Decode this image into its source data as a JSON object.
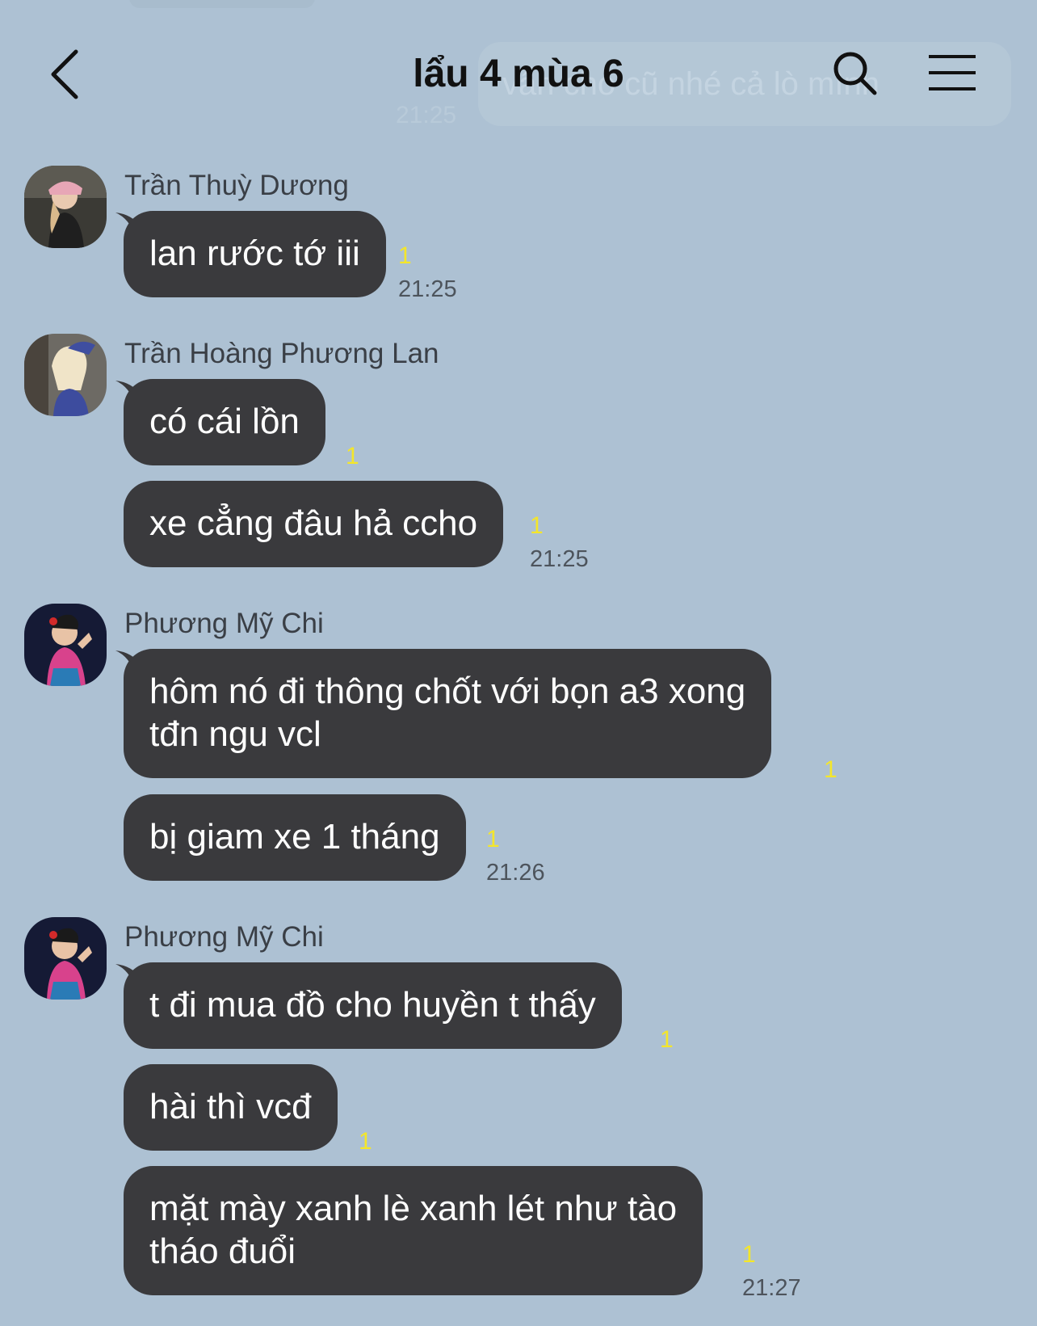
{
  "header": {
    "title": "lẩu 4 mùa 6"
  },
  "background": {
    "ghost_message": "vẫn cho cũ nhé cả lò mình",
    "ghost_time": "21:25"
  },
  "messages": [
    {
      "sender": "Trần Thuỳ Dương",
      "text": "lan rước tớ iii",
      "unread": "1",
      "time": "21:25"
    },
    {
      "sender": "Trần Hoàng Phương Lan",
      "text": "có cái lồn",
      "unread": "1"
    },
    {
      "text": "xe cẳng đâu hả ccho",
      "unread": "1",
      "time": "21:25"
    },
    {
      "sender": "Phương Mỹ Chi",
      "text_lines": [
        "hôm nó đi thông chốt với bọn a3 xong",
        "tđn ngu vcl"
      ],
      "unread": "1"
    },
    {
      "text": "bị giam xe 1 tháng",
      "unread": "1",
      "time": "21:26"
    },
    {
      "sender": "Phương Mỹ Chi",
      "text": "t đi mua đồ cho huyền t thấy",
      "unread": "1"
    },
    {
      "text": "hài thì vcđ",
      "unread": "1"
    },
    {
      "text_lines": [
        "mặt mày xanh lè xanh lét như tào",
        "tháo đuổi"
      ],
      "unread": "1",
      "time": "21:27"
    }
  ],
  "colors": {
    "background": "#adc1d3",
    "bubble": "#3a3a3d",
    "bubble_text": "#ffffff",
    "unread": "#f4e62a",
    "title": "#111111"
  },
  "icons": [
    "back-chevron-icon",
    "search-icon",
    "menu-icon"
  ]
}
